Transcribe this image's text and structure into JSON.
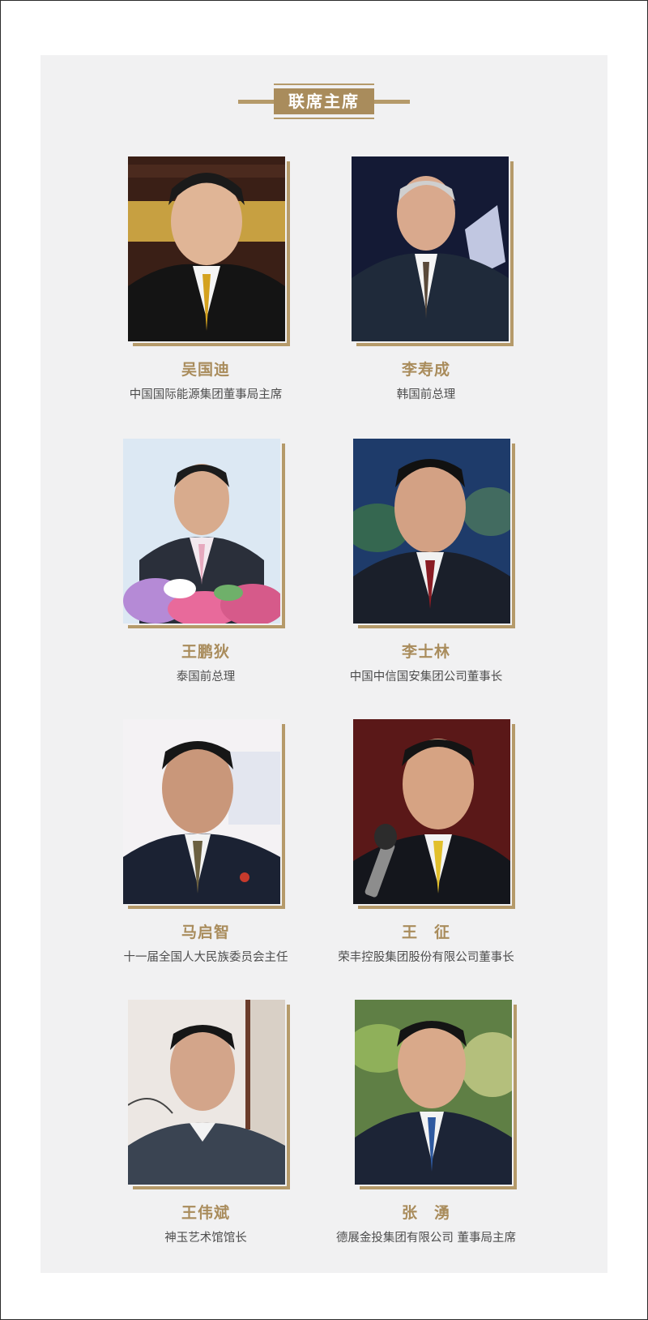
{
  "section": {
    "title": "联席主席"
  },
  "people": [
    {
      "name": "吴国迪",
      "title": "中国国际能源集团董事局主席",
      "photo_label": "portrait-wu-guodi"
    },
    {
      "name": "李寿成",
      "title": "韩国前总理",
      "photo_label": "portrait-li-shoucheng"
    },
    {
      "name": "王鹏狄",
      "title": "泰国前总理",
      "photo_label": "portrait-wang-pengdi"
    },
    {
      "name": "李士林",
      "title": "中国中信国安集团公司董事长",
      "photo_label": "portrait-li-shilin"
    },
    {
      "name": "马启智",
      "title": "十一届全国人大民族委员会主任",
      "photo_label": "portrait-ma-qizhi"
    },
    {
      "name": "王　征",
      "title": "荣丰控股集团股份有限公司董事长",
      "photo_label": "portrait-wang-zheng"
    },
    {
      "name": "王伟斌",
      "title": "神玉艺术馆馆长",
      "photo_label": "portrait-wang-weibin"
    },
    {
      "name": "张　湧",
      "title": "德展金投集团有限公司 董事局主席",
      "photo_label": "portrait-zhang-yong"
    }
  ],
  "colors": {
    "gold": "#a98c5c",
    "gold_line": "#b59a6a",
    "panel": "#f1f1f2",
    "text": "#4d4d4d"
  }
}
